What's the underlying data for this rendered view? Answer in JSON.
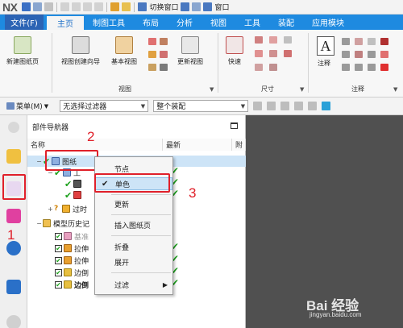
{
  "titlebar": {
    "logo": "NX",
    "switch_window": "切换窗口",
    "window": "窗口"
  },
  "tabs": [
    {
      "label": "文件(F)",
      "kind": "file"
    },
    {
      "label": "主页",
      "kind": "active"
    },
    {
      "label": "制图工具",
      "kind": "norm"
    },
    {
      "label": "布局",
      "kind": "norm"
    },
    {
      "label": "分析",
      "kind": "norm"
    },
    {
      "label": "视图",
      "kind": "norm"
    },
    {
      "label": "工具",
      "kind": "norm"
    },
    {
      "label": "装配",
      "kind": "norm"
    },
    {
      "label": "应用模块",
      "kind": "norm"
    }
  ],
  "ribbon": {
    "new_sheet": "新建图纸页",
    "view_wizard": "视图创建向导",
    "base_view": "基本视图",
    "update_view": "更新视图",
    "quick": "快速",
    "note": "注释",
    "group_view": "视图",
    "group_dimension": "尺寸",
    "group_annotation": "注释"
  },
  "filterbar": {
    "menu": "菜单(M)",
    "filter": "无选择过滤器",
    "scope": "整个装配"
  },
  "navigator": {
    "title": "部件导航器",
    "col_name": "名称",
    "col_latest": "最新",
    "col_extra": "附",
    "rows": [
      {
        "label": "图纸",
        "indent": 0,
        "kind": "drawing"
      },
      {
        "label": "工",
        "indent": 1,
        "kind": "sheet"
      },
      {
        "label": "",
        "indent": 2,
        "kind": "view-a"
      },
      {
        "label": "",
        "indent": 2,
        "kind": "view-b"
      },
      {
        "label": "过时",
        "indent": 1,
        "kind": "outdated"
      },
      {
        "label": "模型历史记",
        "indent": 0,
        "kind": "history"
      },
      {
        "label": "基准",
        "indent": 1,
        "kind": "datum"
      },
      {
        "label": "拉伸",
        "indent": 1,
        "kind": "extrude"
      },
      {
        "label": "拉伸",
        "indent": 1,
        "kind": "extrude"
      },
      {
        "label": "边倒",
        "indent": 1,
        "kind": "blend"
      },
      {
        "label": "边倒",
        "indent": 1,
        "kind": "blend"
      }
    ]
  },
  "context_menu": {
    "items": [
      {
        "label": "节点",
        "checked": false,
        "submenu": false
      },
      {
        "label": "单色",
        "checked": true,
        "submenu": false
      },
      {
        "label": "更新",
        "checked": false,
        "submenu": false
      },
      {
        "label": "插入图纸页",
        "checked": false,
        "submenu": false
      },
      {
        "label": "折叠",
        "checked": false,
        "submenu": false
      },
      {
        "label": "展开",
        "checked": false,
        "submenu": false
      },
      {
        "label": "过滤",
        "checked": false,
        "submenu": true
      }
    ]
  },
  "annotations": {
    "n1": "1",
    "n2": "2",
    "n3": "3"
  },
  "watermark": {
    "main": "Bai 经验",
    "sub": "jingyan.baidu.com"
  },
  "colors": {
    "ribbon_blue": "#1e8ae0",
    "file_tab": "#2b63b4",
    "check_green": "#1da11d",
    "annotation_red": "#e0202a",
    "selection": "#cde4f7",
    "graphics_bg": "#505050"
  }
}
